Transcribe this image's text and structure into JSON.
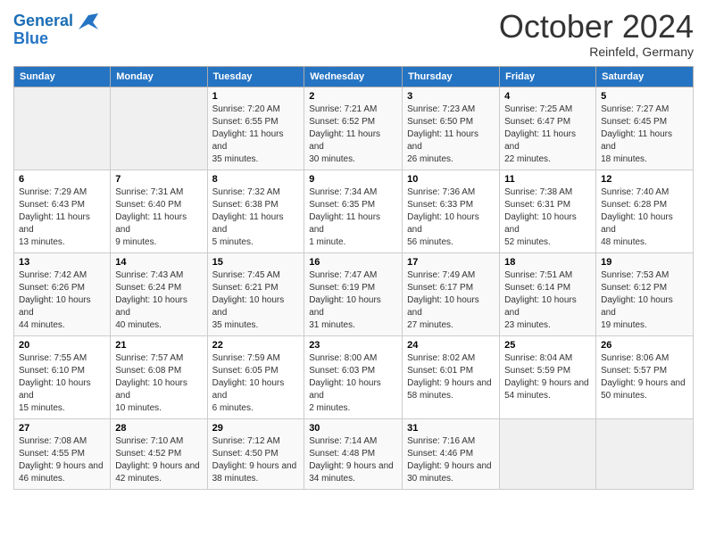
{
  "header": {
    "logo_line1": "General",
    "logo_line2": "Blue",
    "month": "October 2024",
    "location": "Reinfeld, Germany"
  },
  "days_of_week": [
    "Sunday",
    "Monday",
    "Tuesday",
    "Wednesday",
    "Thursday",
    "Friday",
    "Saturday"
  ],
  "weeks": [
    [
      {
        "day": "",
        "sunrise": "",
        "sunset": "",
        "daylight": "",
        "empty": true
      },
      {
        "day": "",
        "sunrise": "",
        "sunset": "",
        "daylight": "",
        "empty": true
      },
      {
        "day": "1",
        "sunrise": "Sunrise: 7:20 AM",
        "sunset": "Sunset: 6:55 PM",
        "daylight": "Daylight: 11 hours and 35 minutes."
      },
      {
        "day": "2",
        "sunrise": "Sunrise: 7:21 AM",
        "sunset": "Sunset: 6:52 PM",
        "daylight": "Daylight: 11 hours and 30 minutes."
      },
      {
        "day": "3",
        "sunrise": "Sunrise: 7:23 AM",
        "sunset": "Sunset: 6:50 PM",
        "daylight": "Daylight: 11 hours and 26 minutes."
      },
      {
        "day": "4",
        "sunrise": "Sunrise: 7:25 AM",
        "sunset": "Sunset: 6:47 PM",
        "daylight": "Daylight: 11 hours and 22 minutes."
      },
      {
        "day": "5",
        "sunrise": "Sunrise: 7:27 AM",
        "sunset": "Sunset: 6:45 PM",
        "daylight": "Daylight: 11 hours and 18 minutes."
      }
    ],
    [
      {
        "day": "6",
        "sunrise": "Sunrise: 7:29 AM",
        "sunset": "Sunset: 6:43 PM",
        "daylight": "Daylight: 11 hours and 13 minutes."
      },
      {
        "day": "7",
        "sunrise": "Sunrise: 7:31 AM",
        "sunset": "Sunset: 6:40 PM",
        "daylight": "Daylight: 11 hours and 9 minutes."
      },
      {
        "day": "8",
        "sunrise": "Sunrise: 7:32 AM",
        "sunset": "Sunset: 6:38 PM",
        "daylight": "Daylight: 11 hours and 5 minutes."
      },
      {
        "day": "9",
        "sunrise": "Sunrise: 7:34 AM",
        "sunset": "Sunset: 6:35 PM",
        "daylight": "Daylight: 11 hours and 1 minute."
      },
      {
        "day": "10",
        "sunrise": "Sunrise: 7:36 AM",
        "sunset": "Sunset: 6:33 PM",
        "daylight": "Daylight: 10 hours and 56 minutes."
      },
      {
        "day": "11",
        "sunrise": "Sunrise: 7:38 AM",
        "sunset": "Sunset: 6:31 PM",
        "daylight": "Daylight: 10 hours and 52 minutes."
      },
      {
        "day": "12",
        "sunrise": "Sunrise: 7:40 AM",
        "sunset": "Sunset: 6:28 PM",
        "daylight": "Daylight: 10 hours and 48 minutes."
      }
    ],
    [
      {
        "day": "13",
        "sunrise": "Sunrise: 7:42 AM",
        "sunset": "Sunset: 6:26 PM",
        "daylight": "Daylight: 10 hours and 44 minutes."
      },
      {
        "day": "14",
        "sunrise": "Sunrise: 7:43 AM",
        "sunset": "Sunset: 6:24 PM",
        "daylight": "Daylight: 10 hours and 40 minutes."
      },
      {
        "day": "15",
        "sunrise": "Sunrise: 7:45 AM",
        "sunset": "Sunset: 6:21 PM",
        "daylight": "Daylight: 10 hours and 35 minutes."
      },
      {
        "day": "16",
        "sunrise": "Sunrise: 7:47 AM",
        "sunset": "Sunset: 6:19 PM",
        "daylight": "Daylight: 10 hours and 31 minutes."
      },
      {
        "day": "17",
        "sunrise": "Sunrise: 7:49 AM",
        "sunset": "Sunset: 6:17 PM",
        "daylight": "Daylight: 10 hours and 27 minutes."
      },
      {
        "day": "18",
        "sunrise": "Sunrise: 7:51 AM",
        "sunset": "Sunset: 6:14 PM",
        "daylight": "Daylight: 10 hours and 23 minutes."
      },
      {
        "day": "19",
        "sunrise": "Sunrise: 7:53 AM",
        "sunset": "Sunset: 6:12 PM",
        "daylight": "Daylight: 10 hours and 19 minutes."
      }
    ],
    [
      {
        "day": "20",
        "sunrise": "Sunrise: 7:55 AM",
        "sunset": "Sunset: 6:10 PM",
        "daylight": "Daylight: 10 hours and 15 minutes."
      },
      {
        "day": "21",
        "sunrise": "Sunrise: 7:57 AM",
        "sunset": "Sunset: 6:08 PM",
        "daylight": "Daylight: 10 hours and 10 minutes."
      },
      {
        "day": "22",
        "sunrise": "Sunrise: 7:59 AM",
        "sunset": "Sunset: 6:05 PM",
        "daylight": "Daylight: 10 hours and 6 minutes."
      },
      {
        "day": "23",
        "sunrise": "Sunrise: 8:00 AM",
        "sunset": "Sunset: 6:03 PM",
        "daylight": "Daylight: 10 hours and 2 minutes."
      },
      {
        "day": "24",
        "sunrise": "Sunrise: 8:02 AM",
        "sunset": "Sunset: 6:01 PM",
        "daylight": "Daylight: 9 hours and 58 minutes."
      },
      {
        "day": "25",
        "sunrise": "Sunrise: 8:04 AM",
        "sunset": "Sunset: 5:59 PM",
        "daylight": "Daylight: 9 hours and 54 minutes."
      },
      {
        "day": "26",
        "sunrise": "Sunrise: 8:06 AM",
        "sunset": "Sunset: 5:57 PM",
        "daylight": "Daylight: 9 hours and 50 minutes."
      }
    ],
    [
      {
        "day": "27",
        "sunrise": "Sunrise: 7:08 AM",
        "sunset": "Sunset: 4:55 PM",
        "daylight": "Daylight: 9 hours and 46 minutes."
      },
      {
        "day": "28",
        "sunrise": "Sunrise: 7:10 AM",
        "sunset": "Sunset: 4:52 PM",
        "daylight": "Daylight: 9 hours and 42 minutes."
      },
      {
        "day": "29",
        "sunrise": "Sunrise: 7:12 AM",
        "sunset": "Sunset: 4:50 PM",
        "daylight": "Daylight: 9 hours and 38 minutes."
      },
      {
        "day": "30",
        "sunrise": "Sunrise: 7:14 AM",
        "sunset": "Sunset: 4:48 PM",
        "daylight": "Daylight: 9 hours and 34 minutes."
      },
      {
        "day": "31",
        "sunrise": "Sunrise: 7:16 AM",
        "sunset": "Sunset: 4:46 PM",
        "daylight": "Daylight: 9 hours and 30 minutes."
      },
      {
        "day": "",
        "sunrise": "",
        "sunset": "",
        "daylight": "",
        "empty": true
      },
      {
        "day": "",
        "sunrise": "",
        "sunset": "",
        "daylight": "",
        "empty": true
      }
    ]
  ]
}
